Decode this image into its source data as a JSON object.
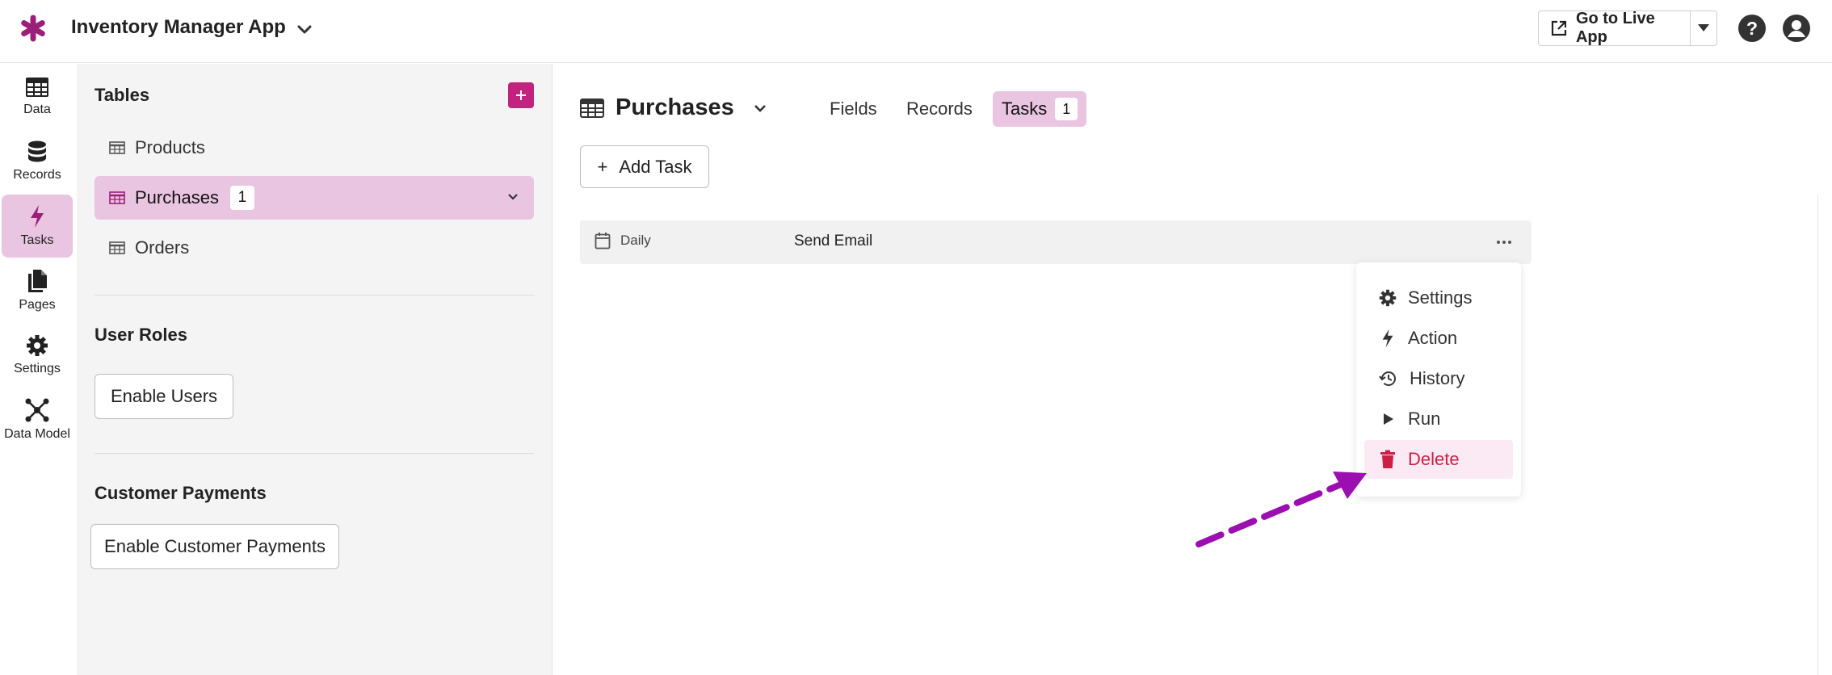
{
  "app": {
    "title": "Inventory Manager App",
    "live_button_label": "Go to Live App",
    "brand_color": "#9b1f78",
    "accent_color": "#c2237e",
    "active_bg": "#e9c5e1"
  },
  "rail": {
    "items": [
      {
        "label": "Data",
        "icon": "table-icon"
      },
      {
        "label": "Records",
        "icon": "database-icon"
      },
      {
        "label": "Tasks",
        "icon": "bolt-icon",
        "active": true
      },
      {
        "label": "Pages",
        "icon": "pages-icon"
      },
      {
        "label": "Settings",
        "icon": "gear-icon"
      },
      {
        "label": "Data Model",
        "icon": "data-model-icon"
      }
    ]
  },
  "sidebar": {
    "tables_title": "Tables",
    "tables": [
      {
        "label": "Products"
      },
      {
        "label": "Purchases",
        "count": "1",
        "active": true
      },
      {
        "label": "Orders"
      }
    ],
    "user_roles_title": "User Roles",
    "enable_users_label": "Enable Users",
    "customer_payments_title": "Customer Payments",
    "enable_payments_label": "Enable Customer Payments"
  },
  "main": {
    "page_title": "Purchases",
    "tabs": [
      {
        "label": "Fields"
      },
      {
        "label": "Records"
      },
      {
        "label": "Tasks",
        "count": "1",
        "active": true
      }
    ],
    "add_task_label": "Add Task",
    "task": {
      "schedule": "Daily",
      "name": "Send Email"
    },
    "menu": [
      {
        "label": "Settings",
        "icon": "gear-icon"
      },
      {
        "label": "Action",
        "icon": "bolt-icon"
      },
      {
        "label": "History",
        "icon": "history-icon"
      },
      {
        "label": "Run",
        "icon": "play-icon"
      },
      {
        "label": "Delete",
        "icon": "trash-icon",
        "danger": true
      }
    ]
  },
  "annotation": {
    "arrow_color": "#9b0fb0"
  }
}
